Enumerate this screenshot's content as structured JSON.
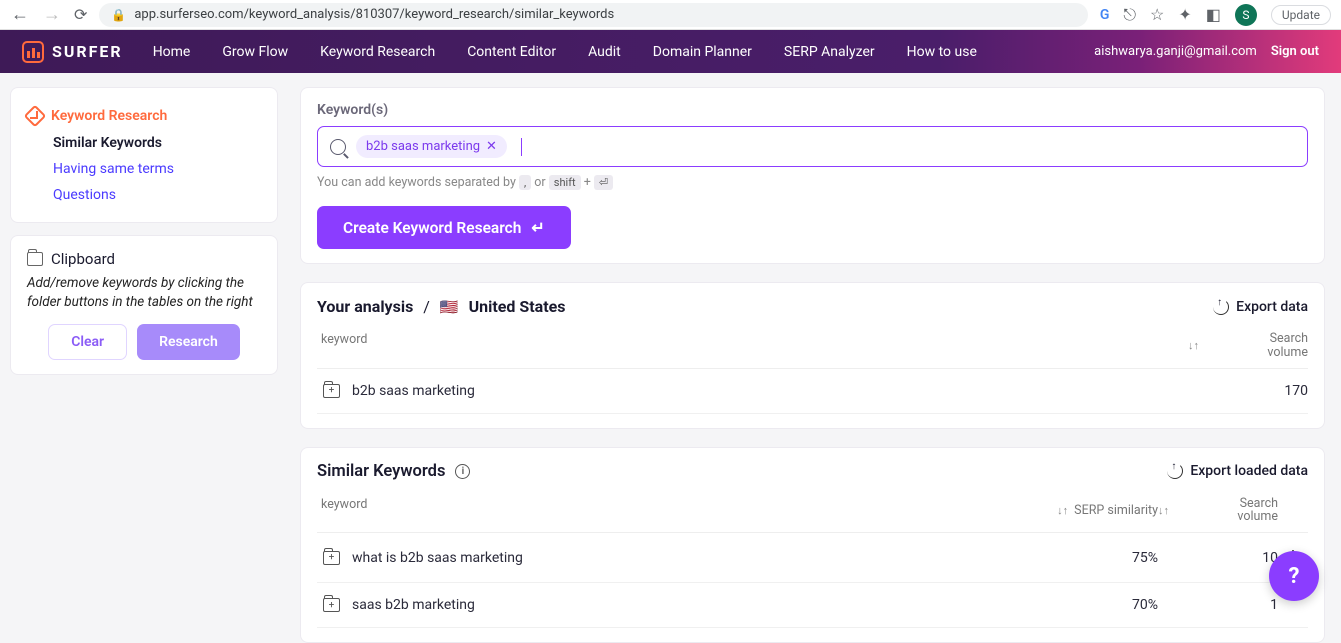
{
  "browser": {
    "url": "app.surferseo.com/keyword_analysis/810307/keyword_research/similar_keywords",
    "avatar_letter": "S",
    "update": "Update"
  },
  "topbar": {
    "brand": "SURFER",
    "nav": [
      "Home",
      "Grow Flow",
      "Keyword Research",
      "Content Editor",
      "Audit",
      "Domain Planner",
      "SERP Analyzer",
      "How to use"
    ],
    "email": "aishwarya.ganji@gmail.com",
    "signout": "Sign out"
  },
  "sidebar": {
    "main": "Keyword Research",
    "subs": [
      "Similar Keywords",
      "Having same terms",
      "Questions"
    ],
    "clipboard_title": "Clipboard",
    "clipboard_desc": "Add/remove keywords by clicking the folder buttons in the tables on the right",
    "clear": "Clear",
    "research": "Research"
  },
  "input": {
    "label": "Keyword(s)",
    "chip": "b2b saas marketing",
    "hint_pre": "You can add keywords separated by ",
    "hint_comma": ",",
    "hint_or": " or ",
    "hint_shift": "shift",
    "hint_plus": " + ",
    "hint_enter": "⏎",
    "create": "Create Keyword Research"
  },
  "analysis": {
    "title_pre": "Your analysis",
    "sep": "/",
    "country": "United States",
    "export": "Export data",
    "col_kw": "keyword",
    "col_vol1": "Search",
    "col_vol2": "volume",
    "row_kw": "b2b saas marketing",
    "row_vol": "170"
  },
  "similar": {
    "title": "Similar Keywords",
    "export": "Export loaded data",
    "col_kw": "keyword",
    "col_serp": "SERP similarity",
    "col_vol1": "Search",
    "col_vol2": "volume",
    "rows": [
      {
        "kw": "what is b2b saas marketing",
        "serp": "75%",
        "vol": "10"
      },
      {
        "kw": "saas b2b marketing",
        "serp": "70%",
        "vol": "1"
      }
    ]
  }
}
